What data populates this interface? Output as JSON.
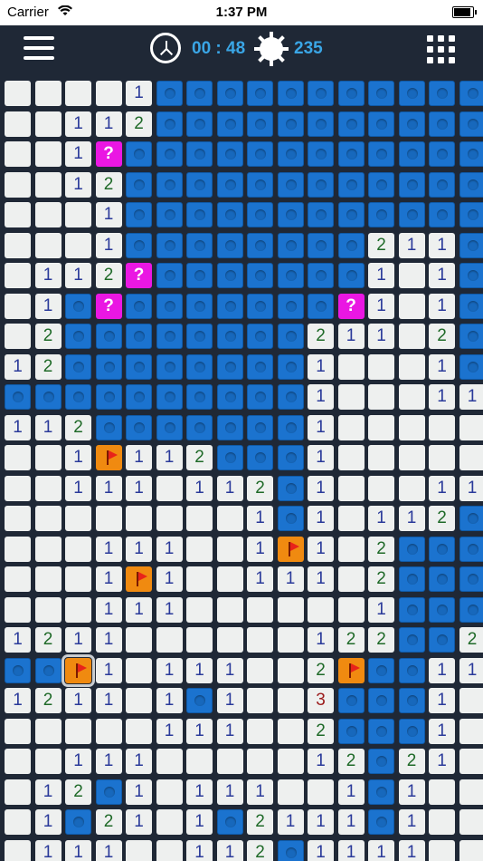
{
  "status_bar": {
    "carrier": "Carrier",
    "time": "1:37 PM"
  },
  "toolbar": {
    "timer": "00 : 48",
    "mines_left": "235"
  },
  "board": {
    "rows": [
      ". . . . 1 # # # # # # # # # # #",
      ". . 1 1 2 # # # # # # # # # # #",
      ". . 1 ? # # # # # # # # # # # #",
      ". . 1 2 # # # # # # # # # # # #",
      ". . . 1 # # # # # # # # # # # #",
      ". . . 1 # # # # # # # # 2 1 1 #",
      ". 1 1 2 ? # # # # # # # 1 . 1 #",
      ". 1 # ? # # # # # # # ? 1 . 1 #",
      ". 2 # # # # # # # # 2 1 1 . 2 #",
      "1 2 # # # # # # # # 1 . . . 1 #",
      "# # # # # # # # # # 1 . . . 1 1",
      "1 1 2 # # # # # # # 1 . . . . .",
      ". . 1 F 1 1 2 # # # 1 . . . . .",
      ". . 1 1 1 . 1 1 2 # 1 . . . 1 1",
      ". . . . . . . . 1 # 1 . 1 1 2 #",
      ". . . 1 1 1 . . 1 F 1 . 2 # # #",
      ". . . 1 F 1 . . 1 1 1 . 2 # # #",
      ". . . 1 1 1 . . . . . . 1 # # #",
      "1 2 1 1 . . . . . . 1 2 2 # # 2",
      "# # F 1 . 1 1 1 . . 2 F # # 1 1",
      "1 2 1 1 . 1 # 1 . . 3 # # # 1 .",
      ". . . . . 1 1 1 . . 2 # # # 1 .",
      ". . 1 1 1 . . . . . 1 2 # 2 1 .",
      ". 1 2 # 1 . 1 1 1 . . 1 # 1 . .",
      ". 1 # 2 1 . 1 # 2 1 1 1 # 1 . .",
      ". 1 1 1 . . 1 1 2 # 1 1 1 1 . ."
    ]
  }
}
